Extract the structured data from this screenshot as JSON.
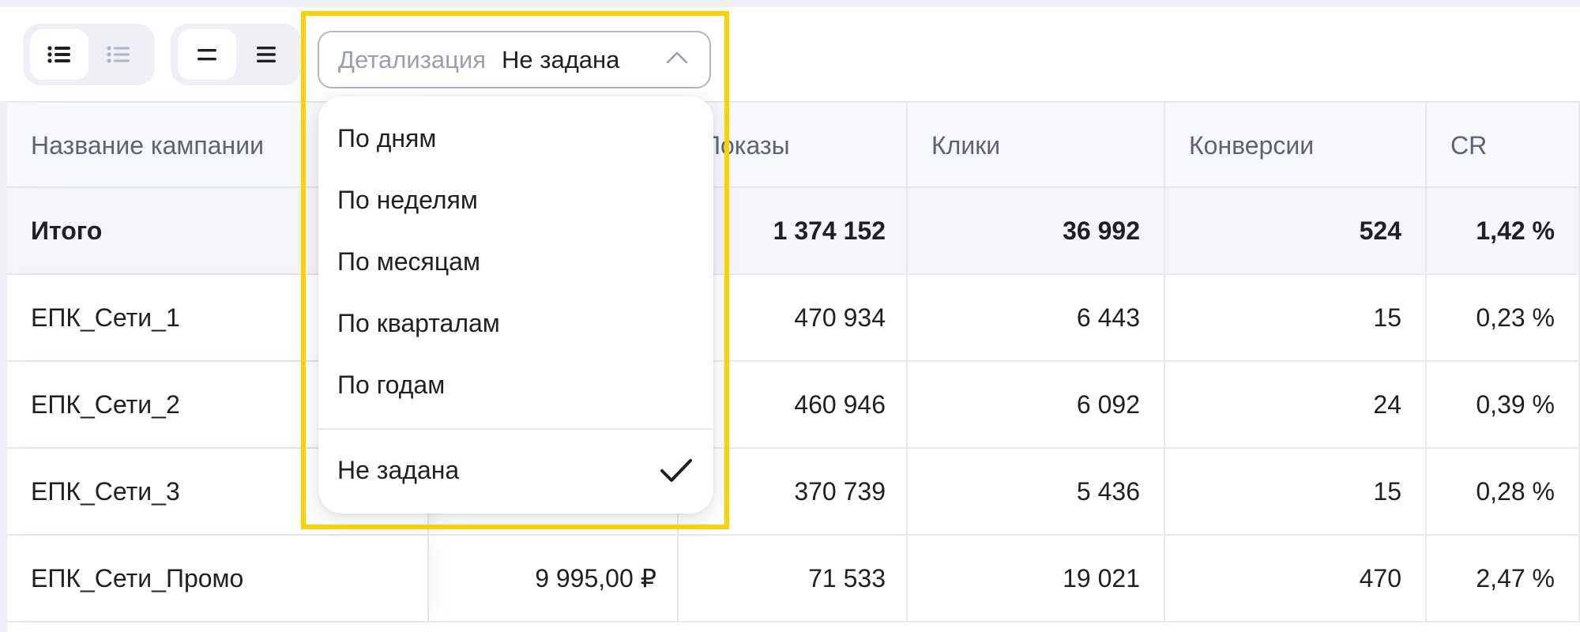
{
  "toolbar": {
    "view_group": [
      {
        "icon": "list-icon",
        "active": true
      },
      {
        "icon": "list-light-icon",
        "active": false
      }
    ],
    "density_group": [
      {
        "icon": "compact-rows-icon",
        "active": true
      },
      {
        "icon": "comfortable-rows-icon",
        "active": false
      }
    ],
    "detail_dropdown": {
      "label": "Детализация",
      "value": "Не задана",
      "expanded": true,
      "icon": "chevron-up-icon"
    }
  },
  "dropdown": {
    "options": [
      {
        "label": "По дням"
      },
      {
        "label": "По неделям"
      },
      {
        "label": "По месяцам"
      },
      {
        "label": "По кварталам"
      },
      {
        "label": "По годам"
      }
    ],
    "selected_option": {
      "label": "Не задана",
      "icon": "check-icon"
    }
  },
  "table": {
    "headers": [
      "Название кампании",
      "Показы",
      "Клики",
      "Конверсии",
      "CR"
    ],
    "total": {
      "name": "Итого",
      "impressions": "1 374 152",
      "clicks": "36 992",
      "conversions": "524",
      "cr": "1,42 %"
    },
    "rows": [
      {
        "name": "ЕПК_Сети_1",
        "impressions": "470 934",
        "clicks": "6 443",
        "conversions": "15",
        "cr": "0,23 %"
      },
      {
        "name": "ЕПК_Сети_2",
        "impressions": "460 946",
        "clicks": "6 092",
        "conversions": "24",
        "cr": "0,39 %"
      },
      {
        "name": "ЕПК_Сети_3",
        "impressions": "370 739",
        "clicks": "5 436",
        "conversions": "15",
        "cr": "0,28 %"
      },
      {
        "name": "ЕПК_Сети_Промо",
        "cost": "9 995,00 ₽",
        "impressions": "71 533",
        "clicks": "19 021",
        "conversions": "470",
        "cr": "2,47 %"
      }
    ]
  },
  "colors": {
    "highlight": "#fcd003",
    "border": "#e6e8ee",
    "muted_text": "#9a9fad",
    "header_text": "#5b6375"
  }
}
